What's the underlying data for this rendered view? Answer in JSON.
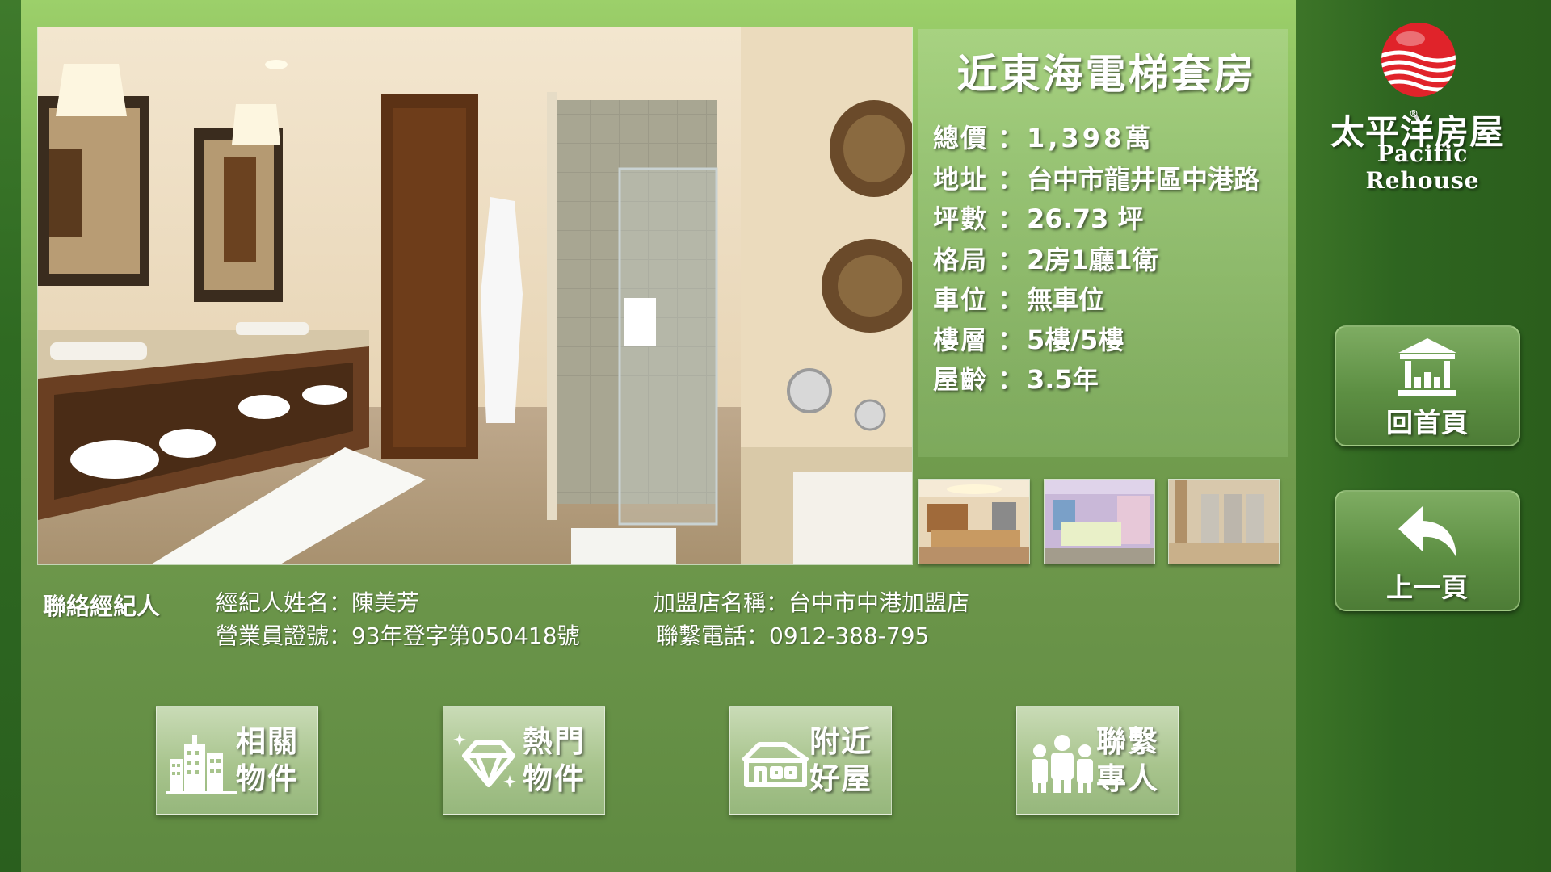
{
  "listing": {
    "title": "近東海電梯套房",
    "specs": [
      {
        "label": "總價",
        "value": "1,398萬"
      },
      {
        "label": "地址",
        "value": "台中市龍井區中港路"
      },
      {
        "label": "坪數",
        "value": "26.73 坪"
      },
      {
        "label": "格局",
        "value": "2房1廳1衛"
      },
      {
        "label": "車位",
        "value": "無車位"
      },
      {
        "label": "樓層",
        "value": "5樓/5樓"
      },
      {
        "label": "屋齡",
        "value": "3.5年"
      }
    ]
  },
  "agent": {
    "heading": "聯絡經紀人",
    "name_line": "經紀人姓名：陳美芳",
    "license_line": "營業員證號：93年登字第050418號",
    "store_line": "加盟店名稱：台中市中港加盟店",
    "phone_line": "聯繫電話：0912-388-795"
  },
  "tiles": [
    {
      "line1": "相關",
      "line2": "物件",
      "icon": "buildings-icon"
    },
    {
      "line1": "熱門",
      "line2": "物件",
      "icon": "diamond-icon"
    },
    {
      "line1": "附近",
      "line2": "好屋",
      "icon": "house-icon"
    },
    {
      "line1": "聯繫",
      "line2": "專人",
      "icon": "people-icon"
    }
  ],
  "brand": {
    "name_cn": "太平洋房屋",
    "name_en": "Pacific Rehouse",
    "registered": "®"
  },
  "nav": {
    "home_label": "回首頁",
    "back_label": "上一頁"
  },
  "colors": {
    "brand_red": "#e0232a",
    "panel_green": "#739f4f",
    "rail_green": "#2e6520"
  }
}
